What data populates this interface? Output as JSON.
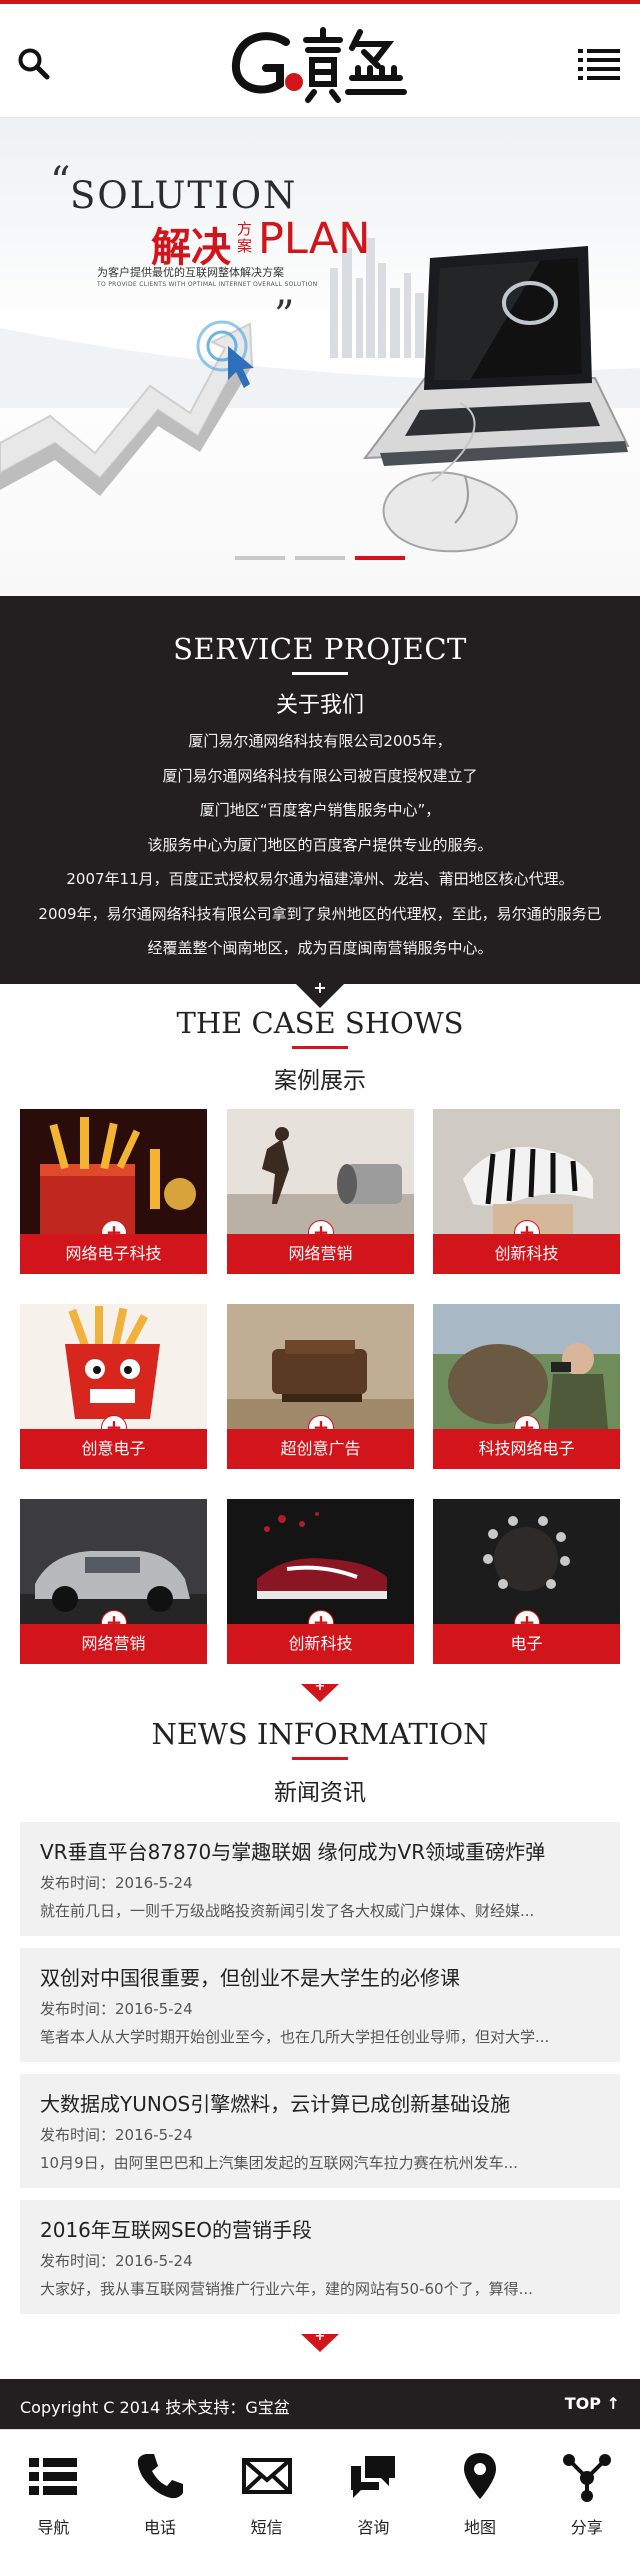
{
  "header": {
    "logo_icon": "g-baoyi-logo"
  },
  "banner": {
    "solution": "SOLUTION",
    "jiejue": "解决",
    "fangan": "方案",
    "plan": "PLAN",
    "subtitle_cn": "为客户提供最优的互联网整体解决方案",
    "subtitle_en": "TO PROVIDE CLIENTS WITH OPTIMAL INTERNET OVERALL SOLUTION",
    "slides_total": 3,
    "active_slide": 3
  },
  "service": {
    "title": "SERVICE PROJECT",
    "subtitle": "关于我们",
    "paragraph": [
      "厦门易尔通网络科技有限公司2005年，",
      "厦门易尔通网络科技有限公司被百度授权建立了",
      "厦门地区“百度客户销售服务中心”，",
      "该服务中心为厦门地区的百度客户提供专业的服务。",
      "2007年11月，百度正式授权易尔通为福建漳州、龙岩、莆田地区核心代理。",
      "2009年，易尔通网络科技有限公司拿到了泉州地区的代理权，至此，易尔通的服务已",
      "经覆盖整个闽南地区，成为百度闽南营销服务中心。"
    ]
  },
  "cases": {
    "title": "THE CASE SHOWS",
    "subtitle": "案例展示",
    "items": [
      {
        "label": "网络电子科技"
      },
      {
        "label": "网络营销"
      },
      {
        "label": "创新科技"
      },
      {
        "label": "创意电子"
      },
      {
        "label": "超创意广告"
      },
      {
        "label": "科技网络电子"
      },
      {
        "label": "网络营销"
      },
      {
        "label": "创新科技"
      },
      {
        "label": "电子"
      }
    ]
  },
  "news": {
    "title": "NEWS INFORMATION",
    "subtitle": "新闻资讯",
    "items": [
      {
        "title": "VR垂直平台87870与掌趣联姻 缘何成为VR领域重磅炸弹",
        "date": "发布时间：2016-5-24",
        "summary": "就在前几日，一则千万级战略投资新闻引发了各大权威门户媒体、财经媒..."
      },
      {
        "title": "双创对中国很重要，但创业不是大学生的必修课",
        "date": "发布时间：2016-5-24",
        "summary": "笔者本人从大学时期开始创业至今，也在几所大学担任创业导师，但对大学..."
      },
      {
        "title": "大数据成YUNOS引擎燃料，云计算已成创新基础设施",
        "date": "发布时间：2016-5-24",
        "summary": "10月9日，由阿里巴巴和上汽集团发起的互联网汽车拉力赛在杭州发车..."
      },
      {
        "title": "2016年互联网SEO的营销手段",
        "date": "发布时间：2016-5-24",
        "summary": "大家好，我从事互联网营销推广行业六年，建的网站有50-60个了，算得..."
      }
    ]
  },
  "footer": {
    "copyright": "Copyright C 2014 技术支持：G宝盆",
    "top": "TOP",
    "nav": [
      {
        "label": "导航",
        "icon": "list-icon"
      },
      {
        "label": "电话",
        "icon": "phone-icon"
      },
      {
        "label": "短信",
        "icon": "envelope-icon"
      },
      {
        "label": "咨询",
        "icon": "chat-icon"
      },
      {
        "label": "地图",
        "icon": "map-pin-icon"
      },
      {
        "label": "分享",
        "icon": "share-icon"
      }
    ]
  },
  "colors": {
    "accent": "#d2141b",
    "dark": "#231f20"
  }
}
